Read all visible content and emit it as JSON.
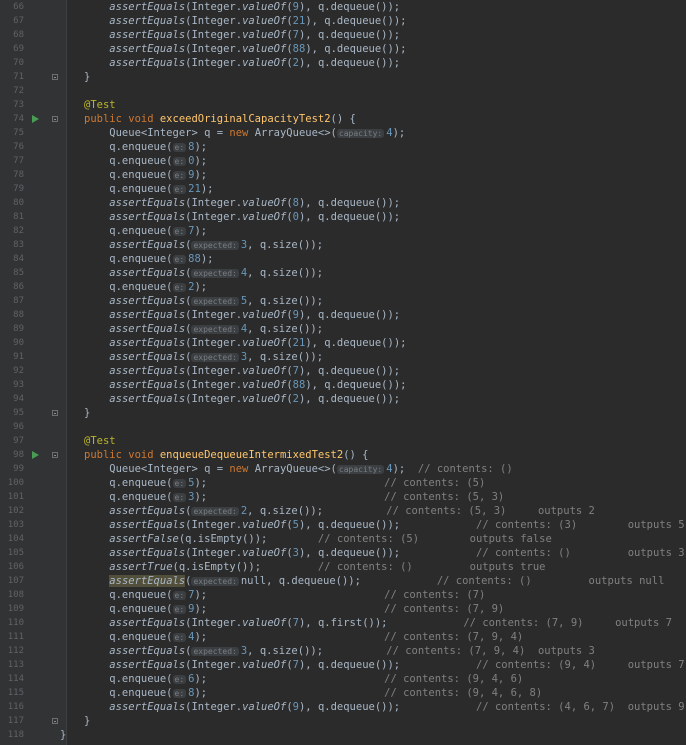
{
  "lines": [
    {
      "n": "66",
      "segs": [
        [
          "    "
        ],
        [
          "assertEquals",
          "st"
        ],
        [
          "(Integer."
        ],
        [
          "valueOf",
          "st"
        ],
        [
          "("
        ],
        [
          "9",
          "num"
        ],
        [
          "), q.dequeue());"
        ]
      ]
    },
    {
      "n": "67",
      "segs": [
        [
          "    "
        ],
        [
          "assertEquals",
          "st"
        ],
        [
          "(Integer."
        ],
        [
          "valueOf",
          "st"
        ],
        [
          "("
        ],
        [
          "21",
          "num"
        ],
        [
          "), q.dequeue());"
        ]
      ]
    },
    {
      "n": "68",
      "segs": [
        [
          "    "
        ],
        [
          "assertEquals",
          "st"
        ],
        [
          "(Integer."
        ],
        [
          "valueOf",
          "st"
        ],
        [
          "("
        ],
        [
          "7",
          "num"
        ],
        [
          "), q.dequeue());"
        ]
      ]
    },
    {
      "n": "69",
      "segs": [
        [
          "    "
        ],
        [
          "assertEquals",
          "st"
        ],
        [
          "(Integer."
        ],
        [
          "valueOf",
          "st"
        ],
        [
          "("
        ],
        [
          "88",
          "num"
        ],
        [
          "), q.dequeue());"
        ]
      ]
    },
    {
      "n": "70",
      "segs": [
        [
          "    "
        ],
        [
          "assertEquals",
          "st"
        ],
        [
          "(Integer."
        ],
        [
          "valueOf",
          "st"
        ],
        [
          "("
        ],
        [
          "2",
          "num"
        ],
        [
          "), q.dequeue());"
        ]
      ]
    },
    {
      "n": "71",
      "fold": true,
      "segs": [
        [
          "}"
        ]
      ]
    },
    {
      "n": "72",
      "segs": []
    },
    {
      "n": "73",
      "segs": [
        [
          "@Test",
          "ann"
        ]
      ]
    },
    {
      "n": "74",
      "run": true,
      "fold": true,
      "segs": [
        [
          "public void ",
          "kw"
        ],
        [
          "exceedOriginalCapacityTest2",
          "fn"
        ],
        [
          "() {"
        ]
      ]
    },
    {
      "n": "75",
      "segs": [
        [
          "    Queue<Integer> q = "
        ],
        [
          "new ",
          "kw"
        ],
        [
          "ArrayQueue<>("
        ],
        [
          "capacity:",
          "hint"
        ],
        [
          "4",
          "num"
        ],
        [
          ");"
        ]
      ]
    },
    {
      "n": "76",
      "segs": [
        [
          "    q.enqueue("
        ],
        [
          "e:",
          "hint"
        ],
        [
          "8",
          "num"
        ],
        [
          ");"
        ]
      ]
    },
    {
      "n": "77",
      "segs": [
        [
          "    q.enqueue("
        ],
        [
          "e:",
          "hint"
        ],
        [
          "0",
          "num"
        ],
        [
          ");"
        ]
      ]
    },
    {
      "n": "78",
      "segs": [
        [
          "    q.enqueue("
        ],
        [
          "e:",
          "hint"
        ],
        [
          "9",
          "num"
        ],
        [
          ");"
        ]
      ]
    },
    {
      "n": "79",
      "segs": [
        [
          "    q.enqueue("
        ],
        [
          "e:",
          "hint"
        ],
        [
          "21",
          "num"
        ],
        [
          ");"
        ]
      ]
    },
    {
      "n": "80",
      "segs": [
        [
          "    "
        ],
        [
          "assertEquals",
          "st"
        ],
        [
          "(Integer."
        ],
        [
          "valueOf",
          "st"
        ],
        [
          "("
        ],
        [
          "8",
          "num"
        ],
        [
          "), q.dequeue());"
        ]
      ]
    },
    {
      "n": "81",
      "segs": [
        [
          "    "
        ],
        [
          "assertEquals",
          "st"
        ],
        [
          "(Integer."
        ],
        [
          "valueOf",
          "st"
        ],
        [
          "("
        ],
        [
          "0",
          "num"
        ],
        [
          "), q.dequeue());"
        ]
      ]
    },
    {
      "n": "82",
      "segs": [
        [
          "    q.enqueue("
        ],
        [
          "e:",
          "hint"
        ],
        [
          "7",
          "num"
        ],
        [
          ");"
        ]
      ]
    },
    {
      "n": "83",
      "segs": [
        [
          "    "
        ],
        [
          "assertEquals",
          "st"
        ],
        [
          "("
        ],
        [
          "expected:",
          "hint"
        ],
        [
          "3",
          "num"
        ],
        [
          ", q.size());"
        ]
      ]
    },
    {
      "n": "84",
      "segs": [
        [
          "    q.enqueue("
        ],
        [
          "e:",
          "hint"
        ],
        [
          "88",
          "num"
        ],
        [
          ");"
        ]
      ]
    },
    {
      "n": "85",
      "segs": [
        [
          "    "
        ],
        [
          "assertEquals",
          "st"
        ],
        [
          "("
        ],
        [
          "expected:",
          "hint"
        ],
        [
          "4",
          "num"
        ],
        [
          ", q.size());"
        ]
      ]
    },
    {
      "n": "86",
      "segs": [
        [
          "    q.enqueue("
        ],
        [
          "e:",
          "hint"
        ],
        [
          "2",
          "num"
        ],
        [
          ");"
        ]
      ]
    },
    {
      "n": "87",
      "segs": [
        [
          "    "
        ],
        [
          "assertEquals",
          "st"
        ],
        [
          "("
        ],
        [
          "expected:",
          "hint"
        ],
        [
          "5",
          "num"
        ],
        [
          ", q.size());"
        ]
      ]
    },
    {
      "n": "88",
      "segs": [
        [
          "    "
        ],
        [
          "assertEquals",
          "st"
        ],
        [
          "(Integer."
        ],
        [
          "valueOf",
          "st"
        ],
        [
          "("
        ],
        [
          "9",
          "num"
        ],
        [
          "), q.dequeue());"
        ]
      ]
    },
    {
      "n": "89",
      "segs": [
        [
          "    "
        ],
        [
          "assertEquals",
          "st"
        ],
        [
          "("
        ],
        [
          "expected:",
          "hint"
        ],
        [
          "4",
          "num"
        ],
        [
          ", q.size());"
        ]
      ]
    },
    {
      "n": "90",
      "segs": [
        [
          "    "
        ],
        [
          "assertEquals",
          "st"
        ],
        [
          "(Integer."
        ],
        [
          "valueOf",
          "st"
        ],
        [
          "("
        ],
        [
          "21",
          "num"
        ],
        [
          "), q.dequeue());"
        ]
      ]
    },
    {
      "n": "91",
      "segs": [
        [
          "    "
        ],
        [
          "assertEquals",
          "st"
        ],
        [
          "("
        ],
        [
          "expected:",
          "hint"
        ],
        [
          "3",
          "num"
        ],
        [
          ", q.size());"
        ]
      ]
    },
    {
      "n": "92",
      "segs": [
        [
          "    "
        ],
        [
          "assertEquals",
          "st"
        ],
        [
          "(Integer."
        ],
        [
          "valueOf",
          "st"
        ],
        [
          "("
        ],
        [
          "7",
          "num"
        ],
        [
          "), q.dequeue());"
        ]
      ]
    },
    {
      "n": "93",
      "segs": [
        [
          "    "
        ],
        [
          "assertEquals",
          "st"
        ],
        [
          "(Integer."
        ],
        [
          "valueOf",
          "st"
        ],
        [
          "("
        ],
        [
          "88",
          "num"
        ],
        [
          "), q.dequeue());"
        ]
      ]
    },
    {
      "n": "94",
      "segs": [
        [
          "    "
        ],
        [
          "assertEquals",
          "st"
        ],
        [
          "(Integer."
        ],
        [
          "valueOf",
          "st"
        ],
        [
          "("
        ],
        [
          "2",
          "num"
        ],
        [
          "), q.dequeue());"
        ]
      ]
    },
    {
      "n": "95",
      "fold": true,
      "segs": [
        [
          "}"
        ]
      ]
    },
    {
      "n": "96",
      "segs": []
    },
    {
      "n": "97",
      "segs": [
        [
          "@Test",
          "ann"
        ]
      ]
    },
    {
      "n": "98",
      "run": true,
      "fold": true,
      "segs": [
        [
          "public void ",
          "kw"
        ],
        [
          "enqueueDequeueIntermixedTest2",
          "fn"
        ],
        [
          "() {"
        ]
      ]
    },
    {
      "n": "99",
      "segs": [
        [
          "    Queue<Integer> q = "
        ],
        [
          "new ",
          "kw"
        ],
        [
          "ArrayQueue<>("
        ],
        [
          "capacity:",
          "hint"
        ],
        [
          "4",
          "num"
        ],
        [
          ");  "
        ],
        [
          "// contents: ()",
          "cm"
        ]
      ]
    },
    {
      "n": "100",
      "segs": [
        [
          "    q.enqueue("
        ],
        [
          "e:",
          "hint"
        ],
        [
          "5",
          "num"
        ],
        [
          ");                            "
        ],
        [
          "// contents: (5)",
          "cm"
        ]
      ]
    },
    {
      "n": "101",
      "segs": [
        [
          "    q.enqueue("
        ],
        [
          "e:",
          "hint"
        ],
        [
          "3",
          "num"
        ],
        [
          ");                            "
        ],
        [
          "// contents: (5, 3)",
          "cm"
        ]
      ]
    },
    {
      "n": "102",
      "segs": [
        [
          "    "
        ],
        [
          "assertEquals",
          "st"
        ],
        [
          "("
        ],
        [
          "expected:",
          "hint"
        ],
        [
          "2",
          "num"
        ],
        [
          ", q.size());          "
        ],
        [
          "// contents: (5, 3)     outputs 2",
          "cm"
        ]
      ]
    },
    {
      "n": "103",
      "segs": [
        [
          "    "
        ],
        [
          "assertEquals",
          "st"
        ],
        [
          "(Integer."
        ],
        [
          "valueOf",
          "st"
        ],
        [
          "("
        ],
        [
          "5",
          "num"
        ],
        [
          "), q.dequeue());            "
        ],
        [
          "// contents: (3)        outputs 5",
          "cm"
        ]
      ]
    },
    {
      "n": "104",
      "segs": [
        [
          "    "
        ],
        [
          "assertFalse",
          "st"
        ],
        [
          "(q.isEmpty());        "
        ],
        [
          "// contents: (5)        outputs false",
          "cm"
        ]
      ]
    },
    {
      "n": "105",
      "segs": [
        [
          "    "
        ],
        [
          "assertEquals",
          "st"
        ],
        [
          "(Integer."
        ],
        [
          "valueOf",
          "st"
        ],
        [
          "("
        ],
        [
          "3",
          "num"
        ],
        [
          "), q.dequeue());            "
        ],
        [
          "// contents: ()         outputs 3",
          "cm"
        ]
      ]
    },
    {
      "n": "106",
      "segs": [
        [
          "    "
        ],
        [
          "assertTrue",
          "st"
        ],
        [
          "(q.isEmpty());         "
        ],
        [
          "// contents: ()         outputs true",
          "cm"
        ]
      ]
    },
    {
      "n": "107",
      "segs": [
        [
          "    "
        ],
        [
          "assertEquals",
          "st hl"
        ],
        [
          "("
        ],
        [
          "expected:",
          "hint"
        ],
        [
          "null, q.dequeue());            "
        ],
        [
          "// contents: ()         outputs null",
          "cm"
        ]
      ]
    },
    {
      "n": "108",
      "segs": [
        [
          "    q.enqueue("
        ],
        [
          "e:",
          "hint"
        ],
        [
          "7",
          "num"
        ],
        [
          ");                            "
        ],
        [
          "// contents: (7)",
          "cm"
        ]
      ]
    },
    {
      "n": "109",
      "segs": [
        [
          "    q.enqueue("
        ],
        [
          "e:",
          "hint"
        ],
        [
          "9",
          "num"
        ],
        [
          ");                            "
        ],
        [
          "// contents: (7, 9)",
          "cm"
        ]
      ]
    },
    {
      "n": "110",
      "segs": [
        [
          "    "
        ],
        [
          "assertEquals",
          "st"
        ],
        [
          "(Integer."
        ],
        [
          "valueOf",
          "st"
        ],
        [
          "("
        ],
        [
          "7",
          "num"
        ],
        [
          "), q.first());            "
        ],
        [
          "// contents: (7, 9)     outputs 7",
          "cm"
        ]
      ]
    },
    {
      "n": "111",
      "segs": [
        [
          "    q.enqueue("
        ],
        [
          "e:",
          "hint"
        ],
        [
          "4",
          "num"
        ],
        [
          ");                            "
        ],
        [
          "// contents: (7, 9, 4)",
          "cm"
        ]
      ]
    },
    {
      "n": "112",
      "segs": [
        [
          "    "
        ],
        [
          "assertEquals",
          "st"
        ],
        [
          "("
        ],
        [
          "expected:",
          "hint"
        ],
        [
          "3",
          "num"
        ],
        [
          ", q.size());          "
        ],
        [
          "// contents: (7, 9, 4)  outputs 3",
          "cm"
        ]
      ]
    },
    {
      "n": "113",
      "segs": [
        [
          "    "
        ],
        [
          "assertEquals",
          "st"
        ],
        [
          "(Integer."
        ],
        [
          "valueOf",
          "st"
        ],
        [
          "("
        ],
        [
          "7",
          "num"
        ],
        [
          "), q.dequeue());            "
        ],
        [
          "// contents: (9, 4)     outputs 7",
          "cm"
        ]
      ]
    },
    {
      "n": "114",
      "segs": [
        [
          "    q.enqueue("
        ],
        [
          "e:",
          "hint"
        ],
        [
          "6",
          "num"
        ],
        [
          ");                            "
        ],
        [
          "// contents: (9, 4, 6)",
          "cm"
        ]
      ]
    },
    {
      "n": "115",
      "segs": [
        [
          "    q.enqueue("
        ],
        [
          "e:",
          "hint"
        ],
        [
          "8",
          "num"
        ],
        [
          ");                            "
        ],
        [
          "// contents: (9, 4, 6, 8)",
          "cm"
        ]
      ]
    },
    {
      "n": "116",
      "segs": [
        [
          "    "
        ],
        [
          "assertEquals",
          "st"
        ],
        [
          "(Integer."
        ],
        [
          "valueOf",
          "st"
        ],
        [
          "("
        ],
        [
          "9",
          "num"
        ],
        [
          "), q.dequeue());            "
        ],
        [
          "// contents: (4, 6, 7)  outputs 9",
          "cm"
        ]
      ]
    },
    {
      "n": "117",
      "fold": true,
      "segs": [
        [
          "}"
        ]
      ]
    },
    {
      "n": "118",
      "segs": [
        [
          "}"
        ]
      ],
      "outer": true
    }
  ]
}
